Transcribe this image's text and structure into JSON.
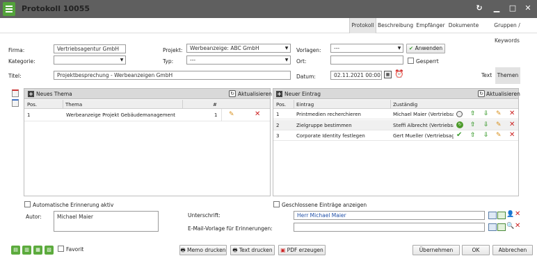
{
  "window": {
    "title": "Protokoll 10055"
  },
  "tabs": [
    "Protokoll",
    "Beschreibung",
    "Empfänger",
    "Dokumente",
    "Gruppen / Keywords"
  ],
  "form": {
    "firma_label": "Firma:",
    "firma_value": "Vertriebsagentur GmbH",
    "kategorie_label": "Kategorie:",
    "kategorie_value": "",
    "titel_label": "Titel:",
    "titel_value": "Projektbesprechung - Werbeanzeigen GmbH",
    "projekt_label": "Projekt:",
    "projekt_value": "Werbeanzeige: ABC GmbH",
    "typ_label": "Typ:",
    "typ_value": "---",
    "vorlagen_label": "Vorlagen:",
    "vorlagen_value": "---",
    "anwenden_label": "Anwenden",
    "ort_label": "Ort:",
    "ort_value": "",
    "gesperrt_label": "Gesperrt",
    "datum_label": "Datum:",
    "datum_value": "02.11.2021 00:00",
    "text_toggle": "Text",
    "themen_toggle": "Themen"
  },
  "themen_panel": {
    "new_label": "Neues Thema",
    "refresh_label": "Aktualisieren",
    "columns": [
      "Pos.",
      "Thema",
      "#"
    ],
    "rows": [
      {
        "pos": "1",
        "thema": "Werbeanzeige Projekt Gebäudemanagement",
        "count": "1"
      }
    ]
  },
  "eintrag_panel": {
    "new_label": "Neuer Eintrag",
    "refresh_label": "Aktualisieren",
    "columns": [
      "Pos.",
      "Eintrag",
      "Zuständig"
    ],
    "rows": [
      {
        "pos": "1",
        "eintrag": "Printmedien recherchieren",
        "zustaendig": "Michael Maier (Vertriebsag",
        "status": "open"
      },
      {
        "pos": "2",
        "eintrag": "Zielgruppe bestimmen",
        "zustaendig": "Steffi Albrecht (Vertriebsag",
        "status": "progress"
      },
      {
        "pos": "3",
        "eintrag": "Corporate Identity festlegen",
        "zustaendig": "Gert Mueller (Vertriebsage",
        "status": "done"
      }
    ]
  },
  "bottom": {
    "auto_reminder_label": "Automatische Erinnerung aktiv",
    "closed_entries_label": "Geschlossene Einträge anzeigen",
    "autor_label": "Autor:",
    "autor_value": "Michael Maier",
    "unterschrift_label": "Unterschrift:",
    "unterschrift_value": "Herr Michael Maier",
    "email_vorlage_label": "E-Mail-Vorlage für Erinnerungen:",
    "email_vorlage_value": "",
    "favorit_label": "Favorit"
  },
  "footer": {
    "memo_label": "Memo drucken",
    "text_label": "Text drucken",
    "pdf_label": "PDF erzeugen",
    "uebernehmen_label": "Übernehmen",
    "ok_label": "OK",
    "abbrechen_label": "Abbrechen"
  },
  "colors": {
    "titlebar": "#5f5f5f",
    "accent_green": "#53a33b",
    "delete_red": "#cc1f1f",
    "link_blue": "#1f4fa8"
  }
}
